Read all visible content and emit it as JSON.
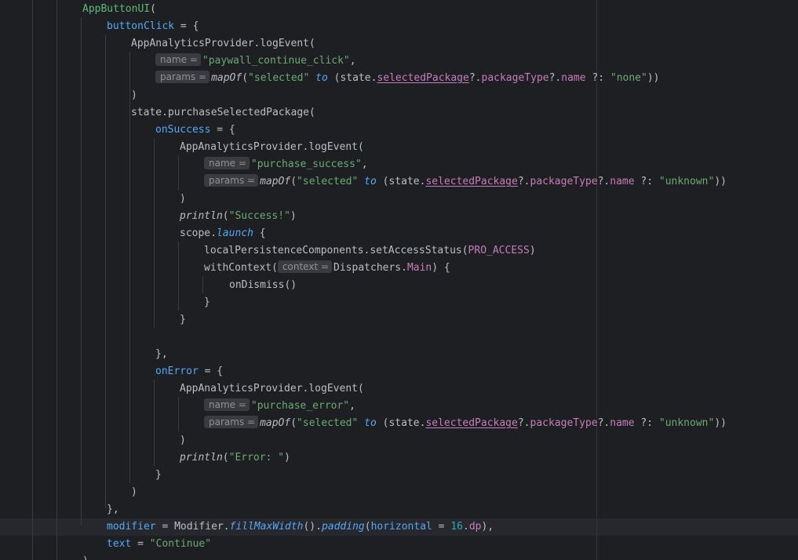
{
  "colors": {
    "background": "#1e1f22",
    "text": "#bcbec4",
    "param": "#56a8f5",
    "string": "#6aab73",
    "property": "#c77dbb",
    "number": "#2aacb8",
    "hint_bg": "#393b40"
  },
  "code": {
    "l1": {
      "call": "AppButtonUI",
      "rest": "("
    },
    "l2": {
      "param": "buttonClick",
      "rest": " = {"
    },
    "l3": {
      "text": "AppAnalyticsProvider.logEvent("
    },
    "l4": {
      "hint": "name =",
      "str": "\"paywall_continue_click\"",
      "rest": ","
    },
    "l5": {
      "hint": "params =",
      "fn": "mapOf",
      "p1": "(",
      "str1": "\"selected\"",
      "to": "to",
      "p2": " (state.",
      "prop1": "selectedPackage",
      "p3": "?.",
      "prop2": "packageType",
      "p4": "?.",
      "prop3": "name",
      "p5": " ?: ",
      "str2": "\"none\"",
      "p6": "))"
    },
    "l6": {
      "text": ")"
    },
    "l7": {
      "text": "state.purchaseSelectedPackage("
    },
    "l8": {
      "param": "onSuccess",
      "rest": " = {"
    },
    "l9": {
      "text": "AppAnalyticsProvider.logEvent("
    },
    "l10": {
      "hint": "name =",
      "str": "\"purchase_success\"",
      "rest": ","
    },
    "l11": {
      "hint": "params =",
      "fn": "mapOf",
      "p1": "(",
      "str1": "\"selected\"",
      "to": "to",
      "p2": " (state.",
      "prop1": "selectedPackage",
      "p3": "?.",
      "prop2": "packageType",
      "p4": "?.",
      "prop3": "name",
      "p5": " ?: ",
      "str2": "\"unknown\"",
      "p6": "))"
    },
    "l12": {
      "text": ")"
    },
    "l13": {
      "fn": "println",
      "p1": "(",
      "str": "\"Success!\"",
      "p2": ")"
    },
    "l14": {
      "obj": "scope.",
      "fn": "launch",
      "rest": " {"
    },
    "l15": {
      "text": "localPersistenceComponents.setAccessStatus(",
      "prop": "PRO_ACCESS",
      "rest": ")"
    },
    "l16": {
      "text": "withContext(",
      "hint": "context =",
      "obj": "Dispatchers.",
      "prop": "Main",
      "rest": ") {"
    },
    "l17": {
      "text": "onDismiss()"
    },
    "l18": {
      "text": "}"
    },
    "l19": {
      "text": "}"
    },
    "l20": {
      "text": "},"
    },
    "l21": {
      "param": "onError",
      "rest": " = {"
    },
    "l22": {
      "text": "AppAnalyticsProvider.logEvent("
    },
    "l23": {
      "hint": "name =",
      "str": "\"purchase_error\"",
      "rest": ","
    },
    "l24": {
      "hint": "params =",
      "fn": "mapOf",
      "p1": "(",
      "str1": "\"selected\"",
      "to": "to",
      "p2": " (state.",
      "prop1": "selectedPackage",
      "p3": "?.",
      "prop2": "packageType",
      "p4": "?.",
      "prop3": "name",
      "p5": " ?: ",
      "str2": "\"unknown\"",
      "p6": "))"
    },
    "l25": {
      "text": ")"
    },
    "l26": {
      "fn": "println",
      "p1": "(",
      "str": "\"Error: \"",
      "p2": ")"
    },
    "l27": {
      "text": "}"
    },
    "l28": {
      "text": ")"
    },
    "l29": {
      "text": "},"
    },
    "l30": {
      "param": "modifier",
      "p1": " = Modifier.",
      "fn1": "fillMaxWidth",
      "p2": "().",
      "fn2": "padding",
      "p3": "(",
      "arg": "horizontal",
      "p4": " = ",
      "num": "16",
      "p5": ".",
      "prop": "dp",
      "p6": "),"
    },
    "l31": {
      "param": "text",
      "p1": " = ",
      "str": "\"Continue\""
    },
    "l32": {
      "text": ")"
    }
  }
}
